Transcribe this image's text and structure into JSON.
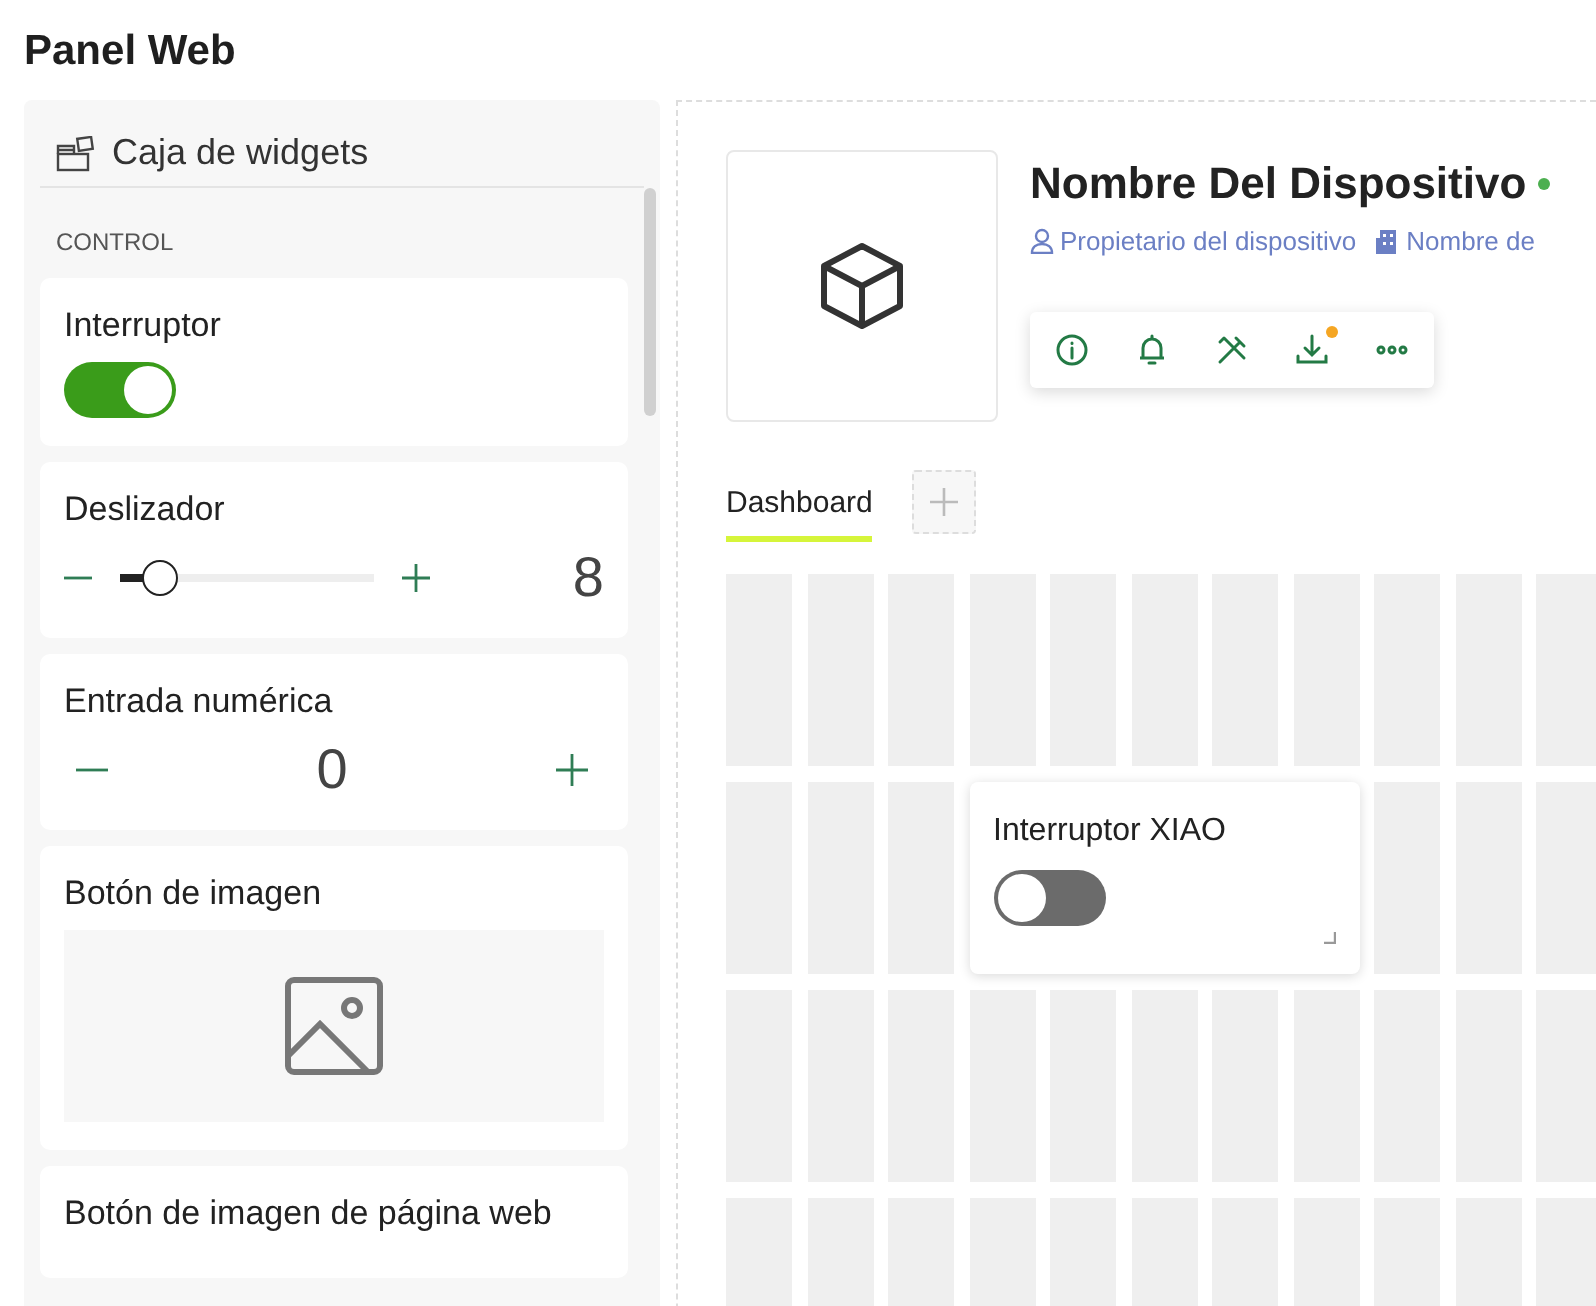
{
  "title": "Panel Web",
  "widget_box": {
    "title": "Caja de widgets",
    "section": "CONTROL",
    "widgets": [
      {
        "kind": "switch",
        "label": "Interruptor",
        "on": true
      },
      {
        "kind": "slider",
        "label": "Deslizador",
        "level": 0.1,
        "value": "8"
      },
      {
        "kind": "number",
        "label": "Entrada numérica",
        "value": "0"
      },
      {
        "kind": "image",
        "label": "Botón de imagen"
      },
      {
        "kind": "webpage",
        "label": "Botón de imagen de página web"
      }
    ]
  },
  "device": {
    "name": "Nombre Del Dispositivo",
    "owner": "Propietario del dispositivo",
    "org": "Nombre de",
    "actions": [
      {
        "kind": "info"
      },
      {
        "kind": "bell"
      },
      {
        "kind": "tools"
      },
      {
        "kind": "download",
        "badge": true
      },
      {
        "kind": "more"
      }
    ]
  },
  "tabs": [
    {
      "label": "Dashboard",
      "selected": true
    }
  ],
  "dashboard": {
    "widgets": [
      {
        "label": "Interruptor XIAO",
        "on": false
      }
    ]
  }
}
